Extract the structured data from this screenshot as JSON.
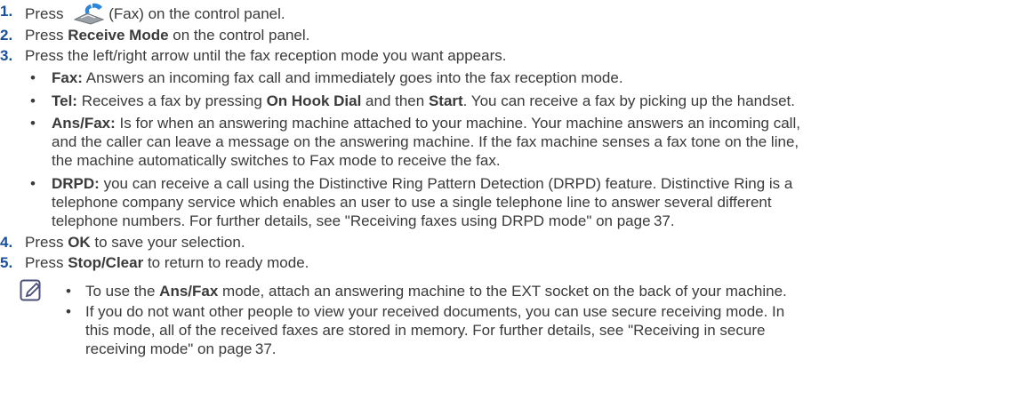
{
  "steps": [
    {
      "num": "1.",
      "before": "Press ",
      "icon": "fax-icon",
      "after": "(Fax) on the control panel."
    },
    {
      "num": "2.",
      "before": "Press ",
      "bold": "Receive Mode",
      "after": " on the control panel."
    },
    {
      "num": "3.",
      "text": "Press the left/right arrow until the fax reception mode you want appears."
    },
    {
      "num": "4.",
      "before": "Press ",
      "bold": "OK",
      "after": " to save your selection."
    },
    {
      "num": "5.",
      "before": "Press ",
      "bold": "Stop/Clear",
      "after": " to return to ready mode."
    }
  ],
  "modes": {
    "fax": {
      "label": "Fax:",
      "text": " Answers an incoming fax call and immediately goes into the fax reception mode."
    },
    "tel": {
      "label": "Tel:",
      "t1": " Receives a fax by pressing ",
      "b1": "On Hook Dial",
      "t2": " and then ",
      "b2": "Start",
      "t3": ". You can receive a fax by picking up the handset."
    },
    "ansfax": {
      "label": "Ans/Fax:",
      "line1": " Is for when an answering machine attached to your machine. Your machine answers an incoming call,",
      "line2": "and the caller can leave a message on the answering machine. If the fax machine senses a fax tone on the line,",
      "line3": "the machine automatically switches to Fax mode to receive the fax."
    },
    "drpd": {
      "label": "DRPD:",
      "line1": " you can receive a call using the Distinctive Ring Pattern Detection (DRPD) feature. Distinctive Ring is a",
      "line2": "telephone company service which enables an user to use a single telephone line to answer several different",
      "line3": "telephone numbers. For further details, see \"Receiving faxes using DRPD mode\" on page 37."
    }
  },
  "note": {
    "icon": "note-pencil-icon",
    "item1": {
      "before": "To use the ",
      "bold": "Ans/Fax",
      "after": " mode, attach an answering machine to the EXT socket on the back of your machine."
    },
    "item2": {
      "line1": "If you do not want other people to view your received documents, you can use secure receiving mode. In",
      "line2": "this mode, all of the received faxes are stored in memory. For further details, see \"Receiving in secure",
      "line3": "receiving mode\" on page 37."
    }
  },
  "bullet_char": "•",
  "colors": {
    "number": "#1a4f9c",
    "text": "#3a3a3a",
    "note_icon": "#4a4f7a"
  }
}
